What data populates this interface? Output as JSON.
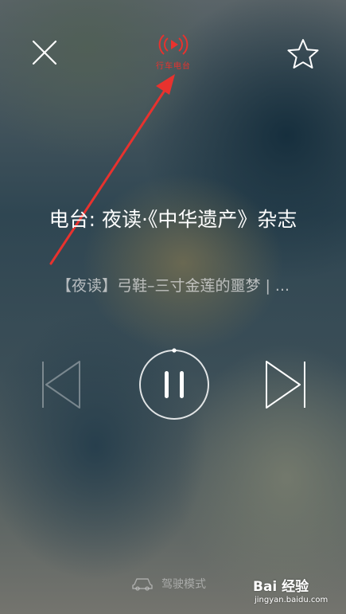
{
  "top_bar": {
    "close_icon": "close-x-icon",
    "favorite_icon": "star-outline-icon",
    "radio_icon": "broadcast-play-icon",
    "radio_label": "行车电台",
    "radio_color": "#e8322e"
  },
  "annotation": {
    "arrow_color": "#e8322e"
  },
  "now_playing": {
    "title": "电台: 夜读·《中华遗产》杂志",
    "subtitle": "【夜读】弓鞋–三寸金莲的噩梦 | ..."
  },
  "controls": {
    "previous_icon": "skip-previous-icon",
    "play_pause_icon": "pause-icon",
    "next_icon": "skip-next-icon",
    "progress": 0.0
  },
  "bottom": {
    "drive_mode_icon": "car-icon",
    "drive_mode_label": "驾驶模式"
  },
  "watermark": {
    "brand": "Bai 经验",
    "url": "jingyan.baidu.com"
  }
}
